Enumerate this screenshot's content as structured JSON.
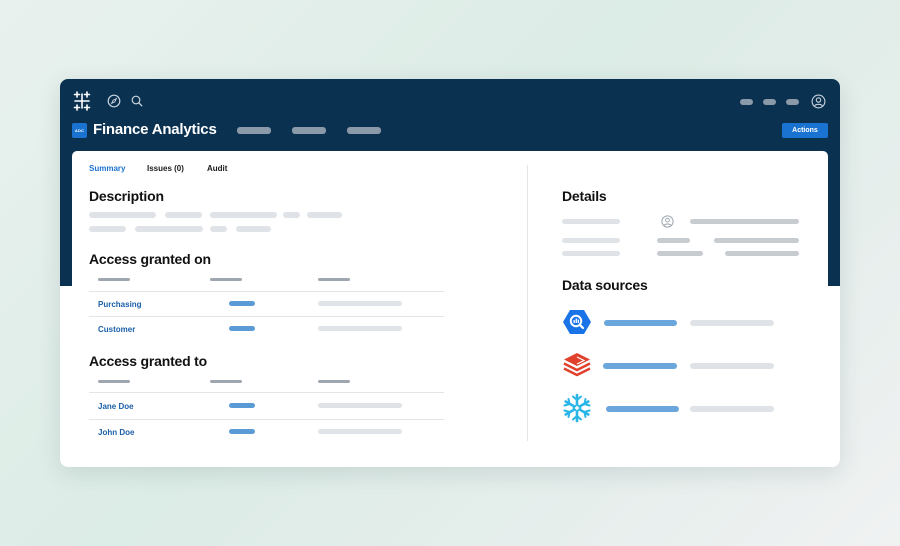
{
  "app": {
    "badge": "ADC",
    "title": "Finance Analytics",
    "actions_label": "Actions"
  },
  "tabs": [
    {
      "label": "Summary",
      "active": true
    },
    {
      "label": "Issues (0)",
      "active": false
    },
    {
      "label": "Audit",
      "active": false
    }
  ],
  "sections": {
    "description": "Description",
    "access_on": "Access granted on",
    "access_to": "Access granted to",
    "details": "Details",
    "data_sources": "Data sources"
  },
  "access_on_rows": [
    "Purchasing",
    "Customer"
  ],
  "access_to_rows": [
    "Jane Doe",
    "John Doe"
  ],
  "data_sources": [
    {
      "icon": "bigquery-icon",
      "color": "#1b73e8"
    },
    {
      "icon": "databricks-icon",
      "color": "#e0402c"
    },
    {
      "icon": "snowflake-icon",
      "color": "#29b5e8"
    }
  ],
  "colors": {
    "navy": "#0a3150",
    "accent": "#1b73d1",
    "link": "#1b5fa8"
  }
}
